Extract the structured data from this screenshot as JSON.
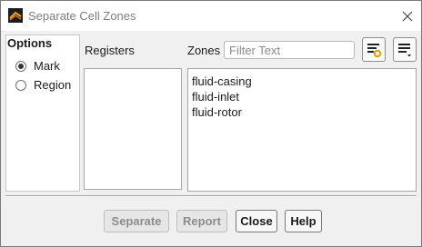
{
  "window": {
    "title": "Separate Cell Zones"
  },
  "options": {
    "title": "Options",
    "radios": [
      {
        "label": "Mark",
        "selected": true
      },
      {
        "label": "Region",
        "selected": false
      }
    ]
  },
  "registers": {
    "label": "Registers",
    "items": []
  },
  "zones": {
    "label": "Zones",
    "filter_placeholder": "Filter Text",
    "items": [
      "fluid-casing",
      "fluid-inlet",
      "fluid-rotor"
    ]
  },
  "toolbar": {
    "filter_button_icon": "filter-sort-icon",
    "list_menu_icon": "list-menu-icon"
  },
  "buttons": {
    "separate": {
      "label": "Separate",
      "enabled": false
    },
    "report": {
      "label": "Report",
      "enabled": false
    },
    "close": {
      "label": "Close",
      "enabled": true
    },
    "help": {
      "label": "Help",
      "enabled": true
    }
  },
  "colors": {
    "app_icon_dark": "#1c1c1c",
    "app_icon_accent": "#f0a020"
  }
}
